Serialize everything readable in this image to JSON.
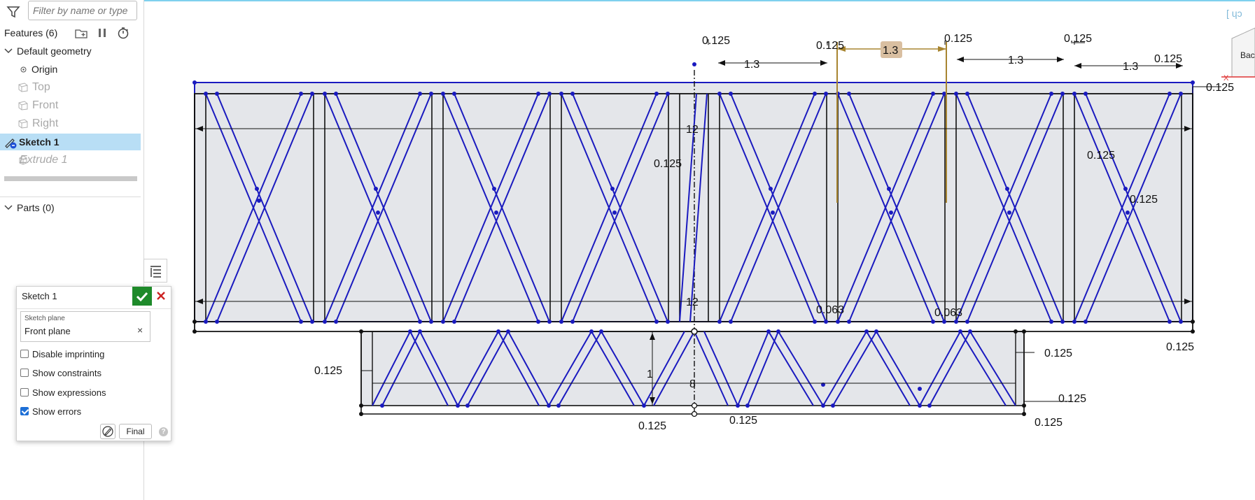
{
  "filter": {
    "placeholder": "Filter by name or type"
  },
  "features": {
    "heading": "Features (6)",
    "default_geometry": "Default geometry",
    "items": [
      {
        "label": "Origin"
      },
      {
        "label": "Top"
      },
      {
        "label": "Front"
      },
      {
        "label": "Right"
      },
      {
        "label": "Sketch 1"
      },
      {
        "label": "Extrude 1"
      }
    ],
    "parts": "Parts (0)"
  },
  "dialog": {
    "title": "Sketch 1",
    "plane_caption": "Sketch plane",
    "plane_value": "Front plane",
    "options": [
      {
        "label": "Disable imprinting",
        "checked": false
      },
      {
        "label": "Show constraints",
        "checked": false
      },
      {
        "label": "Show expressions",
        "checked": false
      },
      {
        "label": "Show errors",
        "checked": true
      }
    ],
    "final_label": "Final"
  },
  "view_cube": {
    "label": "Bac"
  },
  "dimensions": {
    "d1": "0.125",
    "d2": "0.125",
    "d3": "1.3",
    "d4": "0.125",
    "d5": "0.125",
    "d6": "1.3",
    "d7": "1.3",
    "d8": "1.3",
    "d9": "0.125",
    "d10": "0.125",
    "d11": "12",
    "d12": "0.125",
    "d13": "0.125",
    "d14": "0.125",
    "d15": "12",
    "d16": "0.063",
    "d17": "0.063",
    "d18": "0.125",
    "d19": "0.125",
    "d20": "1",
    "d21": "8",
    "d22": "0.125",
    "d23": "0.125",
    "d24": "0.125",
    "d25": "0.125",
    "d26": "0.125"
  },
  "colors": {
    "selection": "#b8def5",
    "sketch_blue": "#1a1abf",
    "region_fill": "#e4e6ea",
    "highlight": "#a88530",
    "accept_green": "#1e8a2a"
  }
}
